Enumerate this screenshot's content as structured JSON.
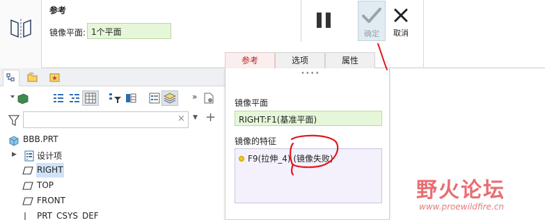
{
  "dashboard": {
    "tab_header": "参考",
    "mirror_plane_label": "镜像平面:",
    "mirror_plane_value": "1个平面",
    "pause_icon": "pause-icon",
    "ok_label": "确定",
    "cancel_label": "取消",
    "tabs": [
      "参考",
      "选项",
      "属性"
    ]
  },
  "model_tree": {
    "filter_placeholder": "",
    "items": [
      {
        "label": "BBB.PRT",
        "icon": "part-icon"
      },
      {
        "label": "设计项",
        "icon": "design-items-icon"
      },
      {
        "label": "RIGHT",
        "icon": "datum-plane-icon",
        "selected": true
      },
      {
        "label": "TOP",
        "icon": "datum-plane-icon"
      },
      {
        "label": "FRONT",
        "icon": "datum-plane-icon"
      },
      {
        "label": "PRT_CSYS_DEF",
        "icon": "csys-icon"
      }
    ]
  },
  "ref_panel": {
    "grip": "••••",
    "mirror_plane_label": "镜像平面",
    "mirror_plane_value": "RIGHT:F1(基准平面)",
    "features_label": "镜像的特征",
    "features": [
      {
        "label": "F9(拉伸_4) (镜像失败)"
      }
    ]
  },
  "watermark": {
    "main": "野火论坛",
    "sub": "www.proewildfire.cn"
  },
  "colors": {
    "selected_tab_text": "#c02020",
    "green_field": "#e6f7d9",
    "feature_box": "#f4f1fc",
    "annotation_red": "#e0161b"
  }
}
